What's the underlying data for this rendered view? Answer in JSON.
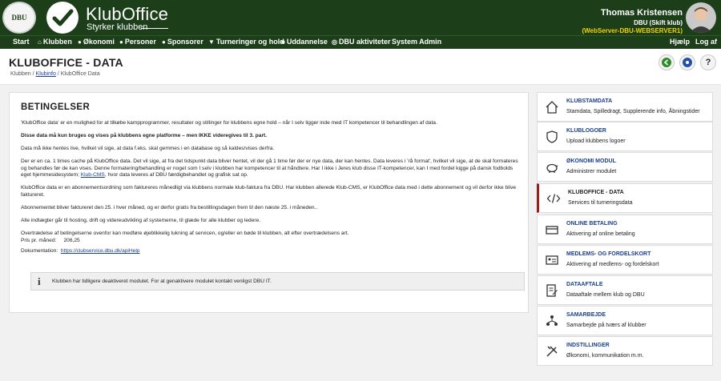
{
  "header": {
    "dbu_logo_text": "DBU",
    "app_title": "KlubOffice",
    "app_subtitle": "Styrker klubben",
    "user": {
      "name": "Thomas Kristensen",
      "club": "DBU (Skift klub)",
      "server": "(WebServer-DBU-WEBSERVER1)"
    }
  },
  "nav": {
    "items": [
      {
        "label": "Start",
        "icon": ""
      },
      {
        "label": "Klubben",
        "icon": "house-icon"
      },
      {
        "label": "Økonomi",
        "icon": "coin-icon"
      },
      {
        "label": "Personer",
        "icon": "person-icon"
      },
      {
        "label": "Sponsorer",
        "icon": "person-icon"
      },
      {
        "label": "Turneringer og hold",
        "icon": "trophy-icon"
      },
      {
        "label": "Uddannelse",
        "icon": "book-icon"
      },
      {
        "label": "DBU aktiviteter",
        "icon": "ball-icon"
      },
      {
        "label": "System Admin",
        "icon": ""
      }
    ],
    "help_label": "Hjælp",
    "logout_label": "Log af"
  },
  "page": {
    "title": "KLUBOFFICE - DATA",
    "breadcrumb": {
      "root": "Klubben",
      "sep": " / ",
      "link": "Klubinfo",
      "current": "KlubOffice Data"
    }
  },
  "main": {
    "section_title": "BETINGELSER",
    "paragraphs": {
      "p1": "'KlubOffice data' er en mulighed for at tilkøbe kampprogrammer, resultater og stillinger for klubbens egne hold – når I selv ligger inde med IT kompetencer til behandlingen af data.",
      "p2": "Disse data må kun bruges og vises på klubbens egne platforme – men IKKE videregives til 3. part.",
      "p3": "Data må ikke hentes live, hvilket vil sige, at data f.eks. skal gemmes i en database og så kaldes/vises derfra.",
      "p4": "Der er en ca. 1 times cache på KlubOffice data. Det vil sige, at fra det tidspunkt data bliver hentet, vil der gå 1 time før der er nye data, der kan hentes. Data leveres i 'rå format', hvilket vil sige, at de skal formateres og behandles før de kan vises. Denne formatering/behandling er noget som I selv i klubben har kompetencer til at håndtere. Har I ikke i Jeres klub disse IT-kompetencer, kan I med fordel kigge på dansk fodbolds eget hjemmesidesystem;",
      "p4_link": "Klub-CMS",
      "p4_end": ", hvor data leveres af DBU færdigbehandlet og grafisk sat op.",
      "p5": "KlubOffice data er en abonnementsordning som faktureres månedligt via klubbens normale klub-faktura fra DBU. Har klubben allerede Klub-CMS, er KlubOffice data med i dette abonnement og vil derfor ikke blive faktureret.",
      "p6": "Abonnementet bliver faktureret den 25. i hver måned, og er derfor gratis fra bestillingsdagen frem til den næste 25. i måneden..",
      "p7": "Alle indtægter går til hosting, drift og videreudvikling af systemerne, til glæde for alle klubber og ledere.",
      "p8": "Overtrædelse af betingelserne ovenfor kan medføre øjeblikkelig lukning af servicen, og/eller en bøde til klubben, alt efter overtrædelsens art."
    },
    "price_label": "Pris pr. måned:",
    "price_value": "206,25",
    "doc_label": "Dokumentation:",
    "doc_link": "https://clubservice.dbu.dk/apiHelp",
    "info_text": "Klubben har tidligere deaktiveret modulet. For at genaktivere modulet kontakt venligst DBU IT."
  },
  "sidebar": {
    "items": [
      {
        "title": "KLUBSTAMDATA",
        "desc": "Stamdata, Spilledragt, Supplerende info, Åbningstider",
        "icon": "house-icon"
      },
      {
        "title": "KLUBLOGOER",
        "desc": "Upload klubbens logoer",
        "icon": "shield-icon"
      },
      {
        "title": "ØKONOMI MODUL",
        "desc": "Administrer modulet",
        "icon": "piggy-bank-icon"
      },
      {
        "title": "KLUBOFFICE - DATA",
        "desc": "Services til turneringsdata",
        "icon": "code-icon"
      },
      {
        "title": "ONLINE BETALING",
        "desc": "Aktivering af online betaling",
        "icon": "credit-card-icon"
      },
      {
        "title": "MEDLEMS- OG FORDELSKORT",
        "desc": "Aktivering af medlems- og fordelskort",
        "icon": "id-card-icon"
      },
      {
        "title": "DATAAFTALE",
        "desc": "Dataaftale mellem klub og DBU",
        "icon": "document-pen-icon"
      },
      {
        "title": "SAMARBEJDE",
        "desc": "Samarbejde på tværs af klubber",
        "icon": "people-network-icon"
      },
      {
        "title": "INDSTILLINGER",
        "desc": "Økonomi, kommunikation m.m.",
        "icon": "tools-icon"
      }
    ]
  },
  "colors": {
    "header_bg": "#1c3f1a",
    "link": "#1a3e8f",
    "active_marker": "#9a1b1b",
    "server_text": "#f2d200"
  }
}
